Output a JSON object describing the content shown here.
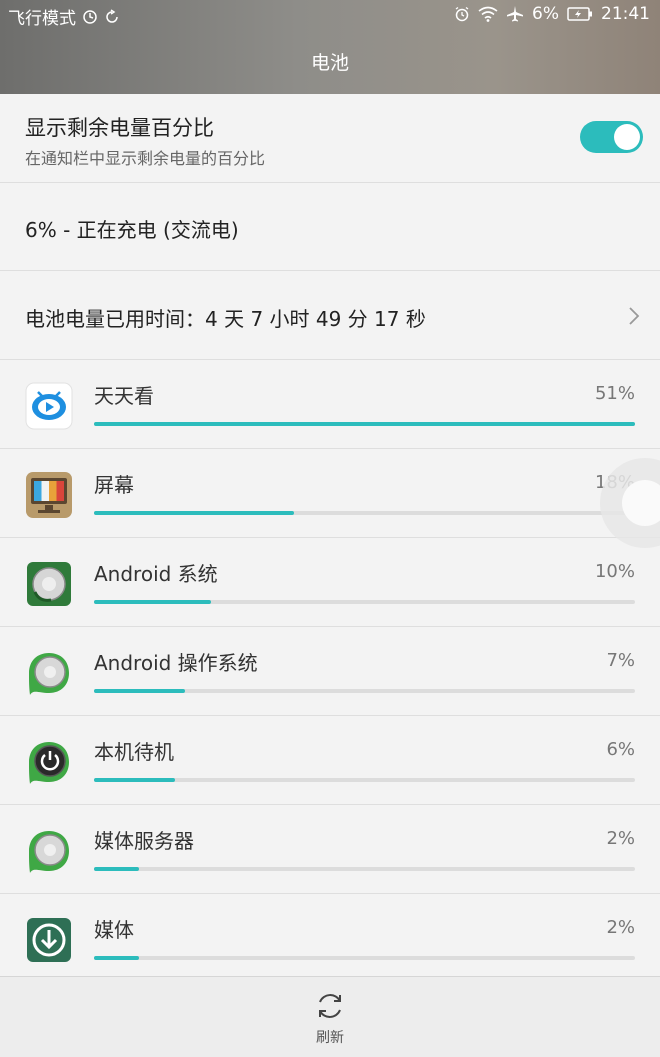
{
  "status_bar": {
    "left_text": "飞行模式",
    "battery_pct": "6%",
    "time": "21:41"
  },
  "page_title": "电池",
  "toggle": {
    "title": "显示剩余电量百分比",
    "subtitle": "在通知栏中显示剩余电量的百分比",
    "on": true
  },
  "charge_status": "6% - 正在充电  (交流电)",
  "usage_time": "电池电量已用时间：4 天 7 小时 49 分 17 秒",
  "apps": [
    {
      "name": "天天看",
      "percent": "51%",
      "fill": 1.0,
      "icon": "video-app-icon"
    },
    {
      "name": "屏幕",
      "percent": "18%",
      "fill": 0.37,
      "icon": "screen-icon"
    },
    {
      "name": "Android 系统",
      "percent": "10%",
      "fill": 0.217,
      "icon": "android-system-icon"
    },
    {
      "name": "Android 操作系统",
      "percent": "7%",
      "fill": 0.168,
      "icon": "android-os-icon"
    },
    {
      "name": "本机待机",
      "percent": "6%",
      "fill": 0.149,
      "icon": "standby-icon"
    },
    {
      "name": "媒体服务器",
      "percent": "2%",
      "fill": 0.083,
      "icon": "media-server-icon"
    },
    {
      "name": "媒体",
      "percent": "2%",
      "fill": 0.083,
      "icon": "media-icon"
    }
  ],
  "footer": {
    "refresh_label": "刷新"
  },
  "colors": {
    "accent": "#2cbcbc",
    "track": "#dcdcdc"
  }
}
